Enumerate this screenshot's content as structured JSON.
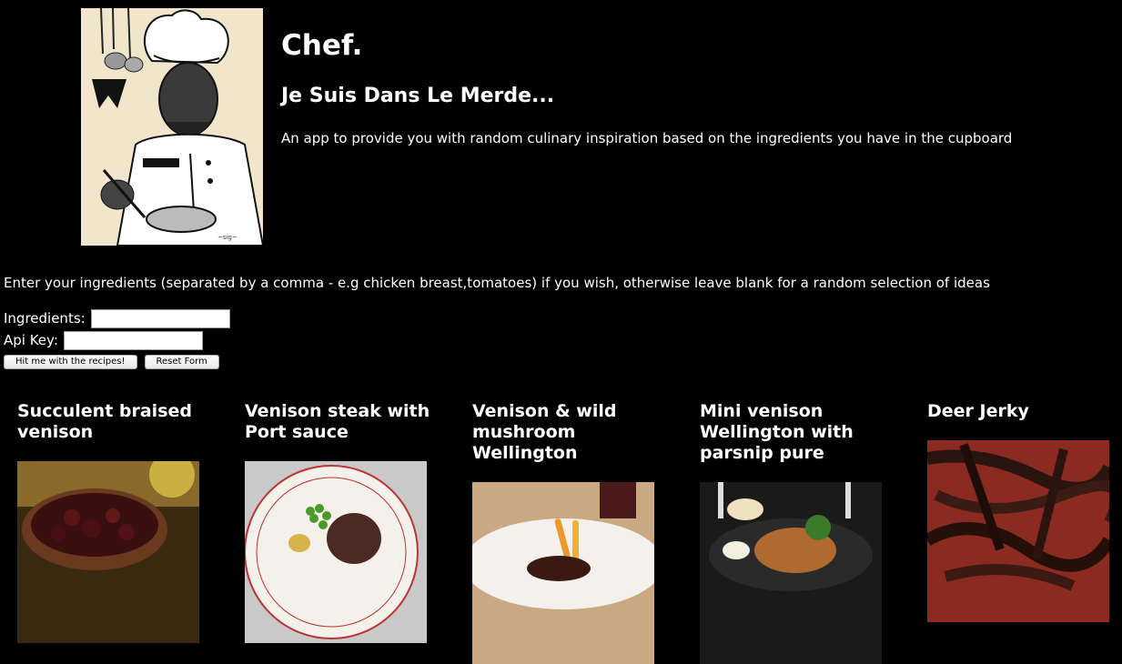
{
  "header": {
    "title": "Chef.",
    "subtitle": "Je Suis Dans Le Merde...",
    "description": "An app to provide you with random culinary inspiration based on the ingredients you have in the cupboard"
  },
  "instructions": "Enter your ingredients (separated by a comma - e.g chicken breast,tomatoes) if you wish, otherwise leave blank for a random selection of ideas",
  "form": {
    "ingredients_label": "Ingredients:",
    "ingredients_value": "",
    "api_key_label": "Api Key:",
    "api_key_value": "",
    "submit_label": "Hit me with the recipes!",
    "reset_label": "Reset Form"
  },
  "recipes": [
    {
      "title": "Succulent braised venison"
    },
    {
      "title": "Venison steak with Port sauce"
    },
    {
      "title": "Venison & wild mushroom Wellington"
    },
    {
      "title": "Mini venison Wellington with parsnip pure"
    },
    {
      "title": "Deer Jerky"
    }
  ]
}
